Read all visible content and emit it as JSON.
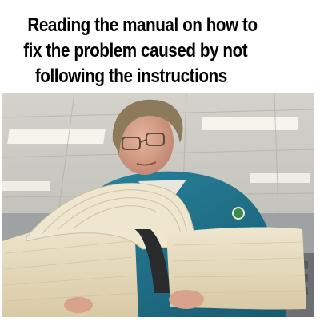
{
  "caption": {
    "lines": [
      "Reading the manual on how to",
      "fix the problem caused by not",
      "following the instructions"
    ]
  },
  "photo": {
    "subject": "person reading a very thick book",
    "colors": {
      "ceiling": "#c9c7c0",
      "light_panel": "#f3f2ea",
      "coat": "#1f6e86",
      "skin": "#d9a28a",
      "hair": "#8c7a5a",
      "pages": "#e8dcc4",
      "page_edge": "#cbbf9e",
      "background_wall": "#9fa3a5"
    }
  }
}
